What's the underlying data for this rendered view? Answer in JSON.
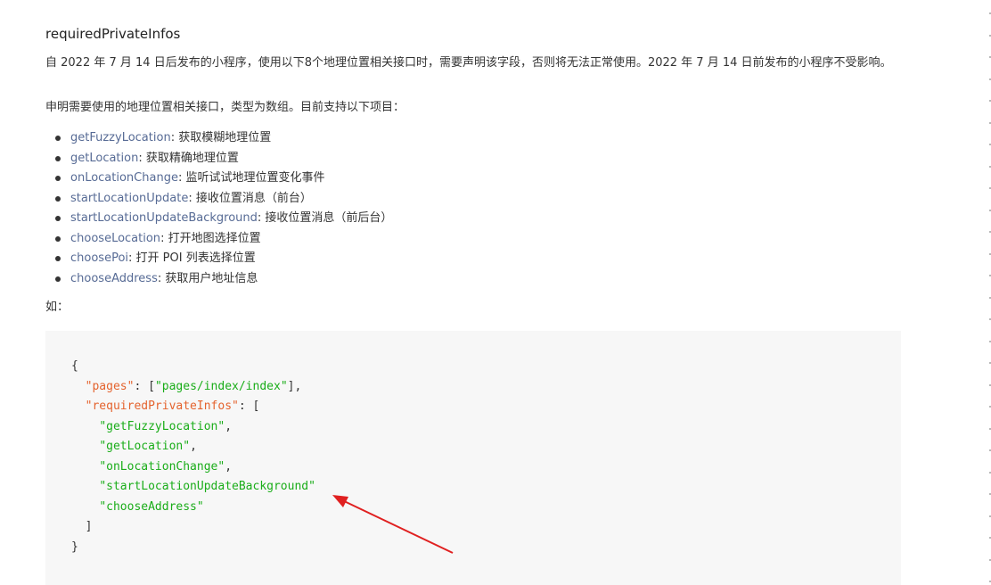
{
  "doc": {
    "title": "requiredPrivateInfos",
    "para1": "自 2022 年 7 月 14 日后发布的小程序，使用以下8个地理位置相关接口时，需要声明该字段，否则将无法正常使用。2022 年 7 月 14 日前发布的小程序不受影响。",
    "para2": "申明需要使用的地理位置相关接口，类型为数组。目前支持以下项目：",
    "api_sep": ": ",
    "apis": [
      {
        "name": "getFuzzyLocation",
        "desc": "获取模糊地理位置"
      },
      {
        "name": "getLocation",
        "desc": "获取精确地理位置"
      },
      {
        "name": "onLocationChange",
        "desc": "监听试试地理位置变化事件"
      },
      {
        "name": "startLocationUpdate",
        "desc": "接收位置消息（前台）"
      },
      {
        "name": "startLocationUpdateBackground",
        "desc": "接收位置消息（前后台）"
      },
      {
        "name": "chooseLocation",
        "desc": "打开地图选择位置"
      },
      {
        "name": "choosePoi",
        "desc": "打开 POI 列表选择位置"
      },
      {
        "name": "chooseAddress",
        "desc": "获取用户地址信息"
      }
    ],
    "example_label": "如："
  },
  "code": {
    "open_brace": "{",
    "pages_key": "\"pages\"",
    "pages_value": "\"pages/index/index\"",
    "rpi_key": "\"requiredPrivateInfos\"",
    "items": [
      "\"getFuzzyLocation\"",
      "\"getLocation\"",
      "\"onLocationChange\"",
      "\"startLocationUpdateBackground\"",
      "\"chooseAddress\""
    ],
    "close_bracket": "]",
    "close_brace": "}"
  },
  "colors": {
    "link": "#576b95",
    "json_key": "#e4632e",
    "json_string": "#1aad19",
    "code_bg": "#f7f7f7",
    "arrow": "#e02020"
  },
  "annotation": {
    "type": "red-arrow",
    "points_to": "startLocationUpdateBackground"
  }
}
